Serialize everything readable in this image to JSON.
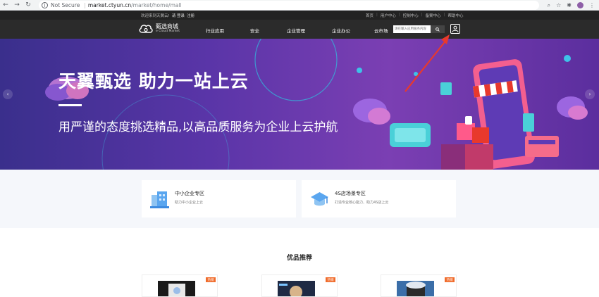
{
  "browser": {
    "security": "Not Secure",
    "url_host": "market.ctyun.cn",
    "url_path": "/market/home/mall"
  },
  "topbar": {
    "welcome": "欢迎来到天翼云!",
    "login": "请 登录",
    "register": "注册",
    "links": [
      "首页",
      "用户中心",
      "控制中心",
      "备案中心",
      "帮助中心"
    ]
  },
  "header": {
    "logo_cn": "甄选商城",
    "logo_en": "e Cloud Market",
    "nav": [
      "行业应用",
      "安全",
      "企业管理",
      "企业办公",
      "云市场"
    ],
    "search_placeholder": "请在输入应用服务内容"
  },
  "hero": {
    "title": "天翼甄选 助力一站上云",
    "subtitle": "用严谨的态度挑选精品,以高品质服务为企业上云护航",
    "arrow_left": "‹",
    "arrow_right": "›"
  },
  "cards": [
    {
      "title": "中小企业专区",
      "desc": "助力中小企业上云"
    },
    {
      "title": "4S店场景专区",
      "desc": "打造专业核心能力、助力4S店上云"
    }
  ],
  "featured": {
    "title": "优品推荐",
    "badge": "热销"
  },
  "colors": {
    "accent_red": "#e8392c",
    "badge_orange": "#f06b2b",
    "header_dark": "#2b2b2b"
  }
}
